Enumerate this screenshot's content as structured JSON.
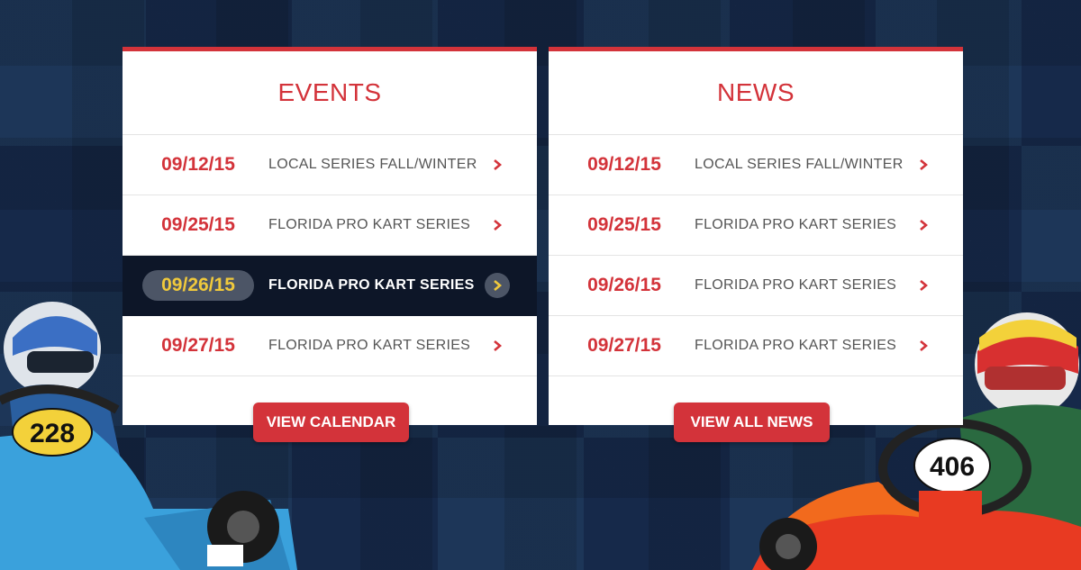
{
  "events": {
    "title": "EVENTS",
    "items": [
      {
        "date": "09/12/15",
        "title": "LOCAL SERIES FALL/WINTER"
      },
      {
        "date": "09/25/15",
        "title": "FLORIDA PRO KART SERIES"
      },
      {
        "date": "09/26/15",
        "title": "FLORIDA PRO KART SERIES"
      },
      {
        "date": "09/27/15",
        "title": "FLORIDA PRO KART SERIES"
      }
    ],
    "button_label": "VIEW CALENDAR"
  },
  "news": {
    "title": "NEWS",
    "items": [
      {
        "date": "09/12/15",
        "title": "LOCAL SERIES FALL/WINTER"
      },
      {
        "date": "09/25/15",
        "title": "FLORIDA PRO KART SERIES"
      },
      {
        "date": "09/26/15",
        "title": "FLORIDA PRO KART SERIES"
      },
      {
        "date": "09/27/15",
        "title": "FLORIDA PRO KART SERIES"
      }
    ],
    "button_label": "VIEW ALL NEWS"
  },
  "karts": {
    "left_number": "228",
    "right_number": "406"
  },
  "colors": {
    "accent": "#d3333a",
    "background": "#1d3658",
    "active_row": "#0d1628",
    "active_date": "#f0c93c"
  },
  "icons": {
    "row_arrow": "chevron-right-icon"
  }
}
